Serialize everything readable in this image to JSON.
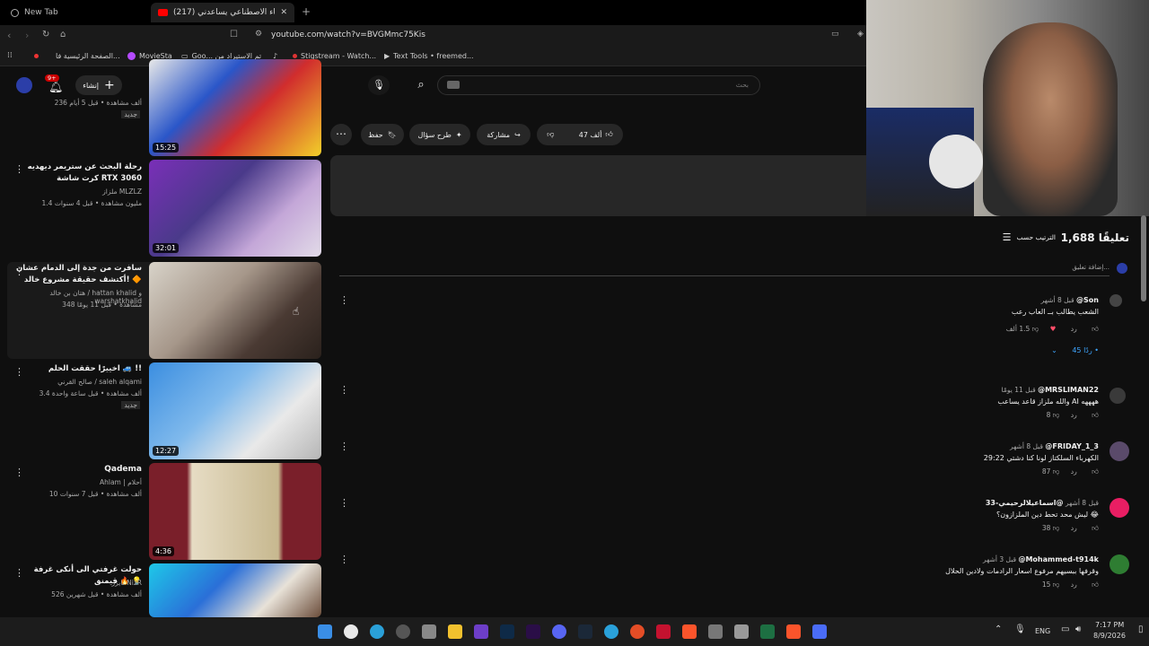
{
  "browser": {
    "tabs": [
      {
        "label": "New Tab"
      },
      {
        "label": "(217) الغباء الاصطناعي يساعدني ..."
      }
    ],
    "url": "youtube.com/watch?v=BVGMmc75Kis",
    "bookmarks": [
      "الصفحة الرئيسية فا...",
      "MovieSta",
      "Goo... تم الاستيراد من",
      "Stigstream - Watch...",
      "Text Tools • freemed..."
    ]
  },
  "youtube": {
    "create_label": "إنشاء",
    "notif_count": "9+",
    "search_placeholder": "بحث",
    "actions": {
      "like_count": "47 ألف",
      "share_label": "مشاركة",
      "ask_label": "طرح سؤال",
      "save_label": "حفظ"
    },
    "comments_count": "1,688 تعليقًا",
    "sort_label": "الترتيب حسب",
    "add_comment_placeholder": "إضافة تعليق..."
  },
  "recommended": [
    {
      "title": "",
      "channel": "",
      "meta": "236 ألف مشاهدة • قبل 5 أيام",
      "badge": "جديد",
      "duration": "15:25"
    },
    {
      "title": "رحلة البحث عن ستريمر ديهديه كرت شاشة RTX 3060",
      "channel": "ملزاز MLZLZ",
      "meta": "1.4 مليون مشاهدة • قبل 4 سنوات",
      "badge": "",
      "duration": "32:01"
    },
    {
      "title": "سافرت من جدة إلى الدمام عشان أكتشف حقيقة مشروع خالد! 🔶",
      "channel": "هتان بن خالد / hattan khalid و warshatkhalid",
      "meta": "348 مشاهدة • قبل 11 يومًا",
      "badge": "",
      "duration": ""
    },
    {
      "title": "اخييرًا حققت الحلم 🚙 !!",
      "channel": "صالح القرني / saleh alqami",
      "meta": "3.4 ألف مشاهدة • قبل ساعة واحدة",
      "badge": "جديد",
      "duration": "12:27"
    },
    {
      "title": "Qadema",
      "channel": "Ahlam | أحلام",
      "meta": "10 ألف مشاهدة • قبل 7 سنوات",
      "badge": "",
      "duration": "4:36"
    },
    {
      "title": "حولت غرفتي الى أنكى غرفة قيمنق 🔥 💡",
      "channel": "نايزر NizR",
      "meta": "526 ألف مشاهدة • قبل شهرين",
      "badge": "",
      "duration": ""
    }
  ],
  "comments": [
    {
      "author": "@Son",
      "time": "قبل 8 أشهر",
      "text": "الشعب يطالب بــ العاب رعب",
      "likes": "1.5 ألف",
      "reply": "رد",
      "replies_count": "45 ردًا •"
    },
    {
      "author": "@MRSLIMAN22",
      "time": "قبل 11 يومًا",
      "text": "والله ملزاز قاعد يساعب AI ههههه",
      "likes": "8",
      "reply": "رد"
    },
    {
      "author": "@FRIDAY_1_3",
      "time": "قبل 8 أشهر",
      "text": "29:22 الكهرباء السلكتاز لونا كنا دشتي",
      "likes": "87",
      "reply": "رد"
    },
    {
      "author": "@اسماعيلالرحيمي-33",
      "time": "قبل 8 أشهر",
      "text": "ليش محد تحط دين الملزازون؟ 😂",
      "likes": "38",
      "reply": "رد"
    },
    {
      "author": "@Mohammed-t914k",
      "time": "قبل 3 أشهر",
      "text": "وقرفها ببسيهم مرفوع اسعار الرادمات ولادين الحلال",
      "likes": "15",
      "reply": "رد"
    }
  ],
  "taskbar": {
    "lang": "ENG",
    "time": "7:17 PM",
    "date": "8/9/2026"
  }
}
